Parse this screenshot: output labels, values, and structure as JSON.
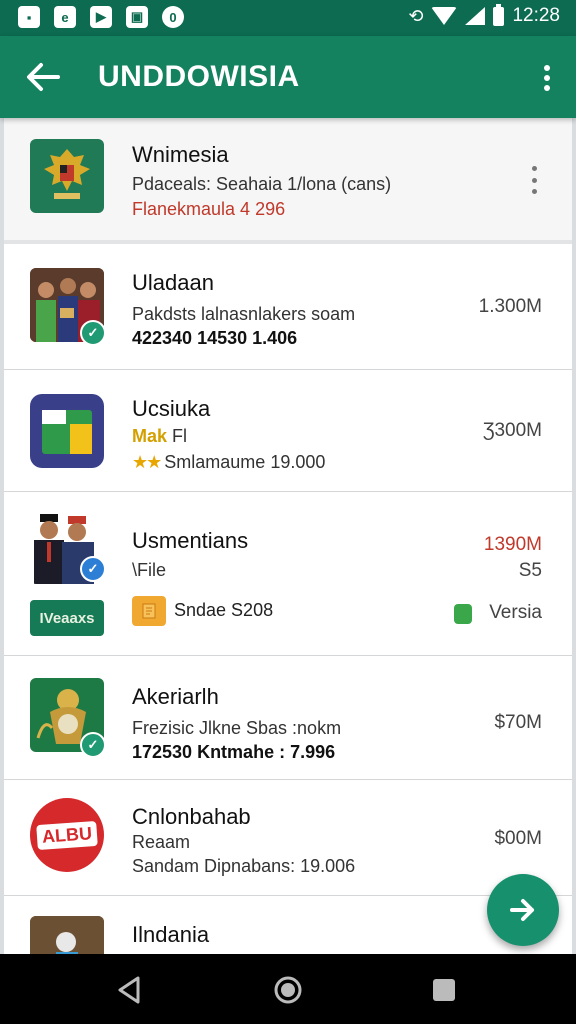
{
  "status_bar": {
    "time": "12:28",
    "left_icons": [
      "image-icon",
      "chat-icon",
      "video-icon",
      "photo-icon",
      "circle-app-icon"
    ]
  },
  "app_bar": {
    "title": "UNDDOWISIA"
  },
  "featured": {
    "name": "Wnimesia",
    "line1": "Pdaceals: Seahaia 1/lona (cans)",
    "line2": "Flanekmaula  4 296"
  },
  "rows": [
    {
      "name": "Uladaan",
      "line1": "Pakdsts lalnasnlakers soam",
      "line2": "422340 14530 1.406",
      "price": "1.300M"
    },
    {
      "name": "Ucsiuka",
      "tag_a": "Mak",
      "tag_b": "Fl",
      "line2": "Smlamaume 19.000",
      "price": "Ʒ300M"
    },
    {
      "name": "Usmentians",
      "line1": "\\File",
      "price": "1390M",
      "price2": "S5",
      "badge": "IVeaaxs",
      "tag": "Sndae S208",
      "version": "Versia"
    },
    {
      "name": "Akeriarlh",
      "line1": "Frezisic Jlkne Sbas :nokm",
      "line2": "172530 Kntmahe : 7.996",
      "price": "$70M"
    },
    {
      "name": "Cnlonbahab",
      "line1": "Reaam",
      "line2": "Sandam Dipnabans: 19.006",
      "price": "$00M",
      "logo_text": "ALBU"
    },
    {
      "name": "Ilndania",
      "line1": ""
    }
  ]
}
